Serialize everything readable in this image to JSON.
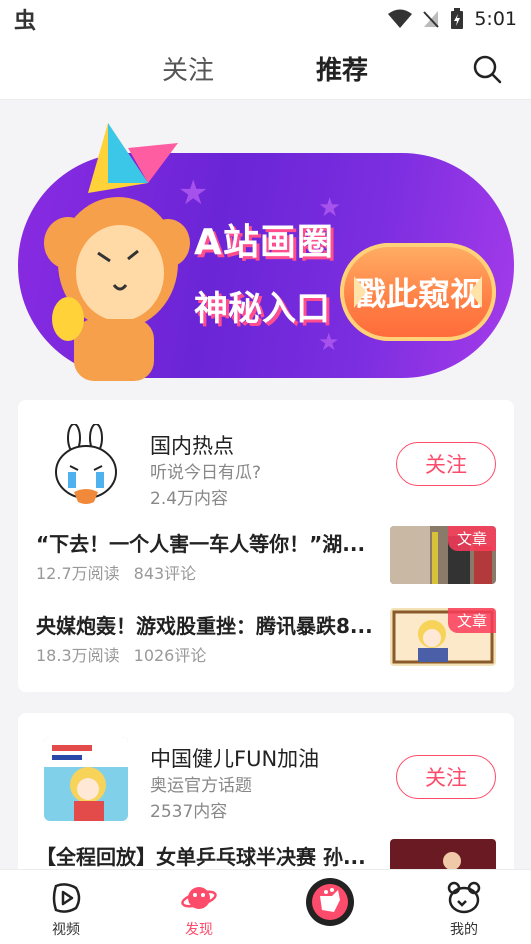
{
  "status_bar": {
    "app_glyph": "虫",
    "time": "5:01"
  },
  "top_tabs": {
    "follow": "关注",
    "recommend": "推荐"
  },
  "banner": {
    "title_line1": "A站画圈",
    "title_line2": "神秘入口",
    "cta": "戳此窥视"
  },
  "topics": [
    {
      "name": "国内热点",
      "description": "听说今日有瓜?",
      "content_count": "2.4万内容",
      "follow_label": "关注",
      "articles": [
        {
          "title": "“下去！一个人害一车人等你！”湖...",
          "reads": "12.7万阅读",
          "comments": "843评论",
          "badge": "文章"
        },
        {
          "title": "央媒炮轰！游戏股重挫：腾讯暴跌8...",
          "reads": "18.3万阅读",
          "comments": "1026评论",
          "badge": "文章"
        }
      ]
    },
    {
      "name": "中国健儿FUN加油",
      "description": "奥运官方话题",
      "content_count": "2537内容",
      "follow_label": "关注",
      "articles": [
        {
          "title": "【全程回放】女单乒乓球半决赛 孙..."
        }
      ]
    }
  ],
  "bottom_nav": {
    "video": "视频",
    "discover": "发现",
    "mine": "我的"
  },
  "colors": {
    "accent": "#fd4c6b",
    "banner_purple": "#7b2ee0",
    "cta_orange": "#ff7f45"
  }
}
